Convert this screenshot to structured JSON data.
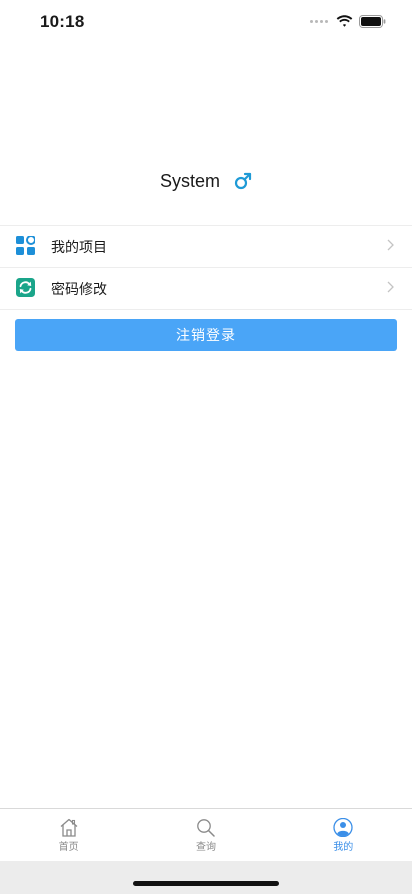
{
  "status_bar": {
    "time": "10:18"
  },
  "profile": {
    "name": "System",
    "gender_icon": "male-symbol-icon"
  },
  "menu": {
    "items": [
      {
        "label": "我的项目",
        "icon": "grid-icon"
      },
      {
        "label": "密码修改",
        "icon": "refresh-icon"
      }
    ]
  },
  "logout": {
    "label": "注销登录"
  },
  "tab_bar": {
    "tabs": [
      {
        "label": "首页",
        "icon": "home-icon",
        "active": false
      },
      {
        "label": "查询",
        "icon": "search-icon",
        "active": false
      },
      {
        "label": "我的",
        "icon": "user-icon",
        "active": true
      }
    ]
  },
  "colors": {
    "accent": "#4aa5f7",
    "tab_active": "#3b8fe8",
    "male_symbol": "#1e9ad6",
    "grid_icon": "#1d8fd8",
    "refresh_icon": "#1aa58a"
  }
}
